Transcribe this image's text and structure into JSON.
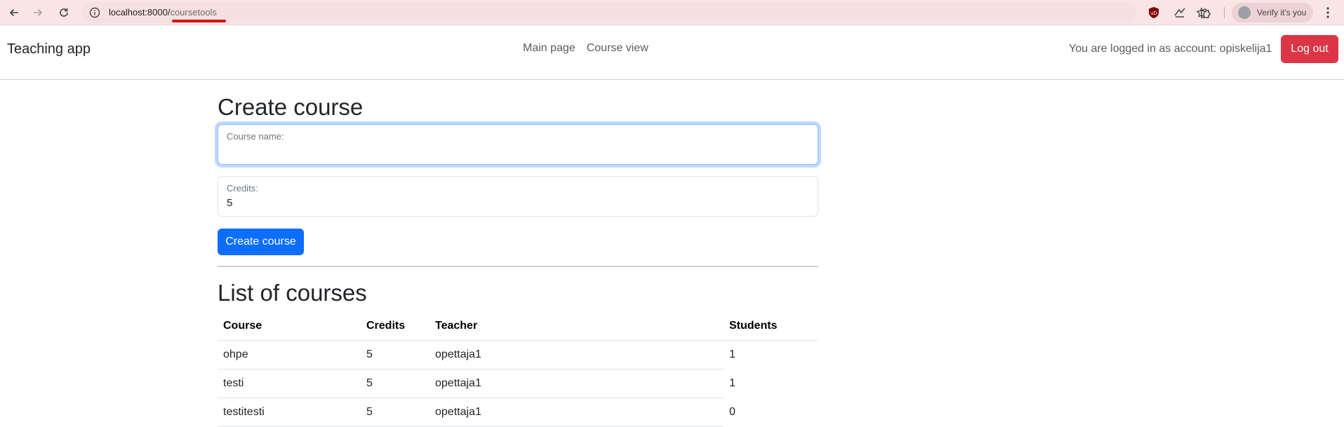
{
  "browser": {
    "url_host": "localhost:8000/",
    "url_path": "coursetools",
    "profile_label": "Verify it's you",
    "icons": [
      "back-icon",
      "forward-icon",
      "reload-icon",
      "site-info-icon",
      "bookmark-star-icon",
      "ublock-icon",
      "extension-icon",
      "puzzle-icon",
      "profile-avatar-icon",
      "menu-dots-icon"
    ]
  },
  "navbar": {
    "brand": "Teaching app",
    "links": [
      "Main page",
      "Course view"
    ],
    "login_text": "You are logged in as account: opiskelija1",
    "logout_label": "Log out",
    "logout_color": "#dc3545"
  },
  "create_form": {
    "title": "Create course",
    "name_label": "Course name:",
    "name_value": "",
    "credits_label": "Credits:",
    "credits_value": "5",
    "submit_label": "Create course",
    "submit_color": "#0d6efd"
  },
  "course_list": {
    "title": "List of courses",
    "columns": [
      "Course",
      "Credits",
      "Teacher",
      "Students"
    ],
    "rows": [
      [
        "ohpe",
        "5",
        "opettaja1",
        "1"
      ],
      [
        "testi",
        "5",
        "opettaja1",
        "1"
      ],
      [
        "testitesti",
        "5",
        "opettaja1",
        "0"
      ]
    ]
  }
}
